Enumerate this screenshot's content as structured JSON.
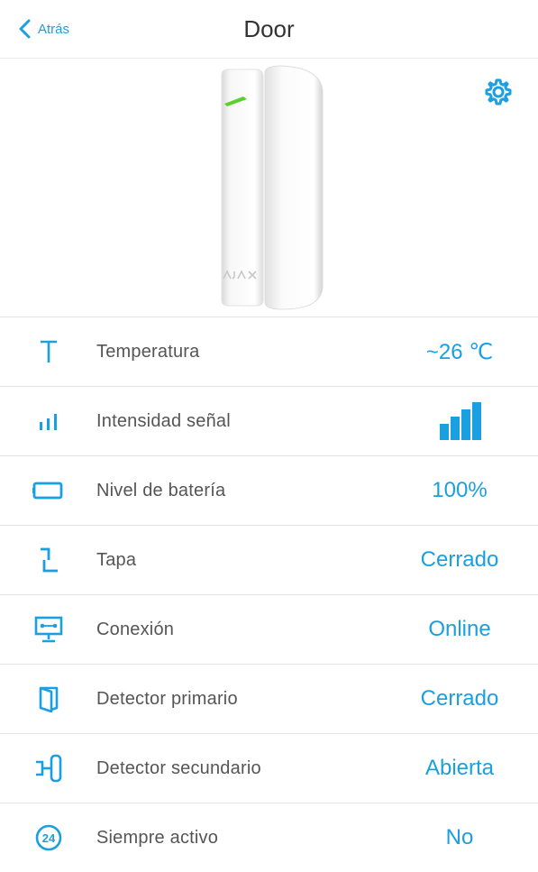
{
  "header": {
    "back_label": "Atrás",
    "title": "Door"
  },
  "hero": {
    "device_logo": "AJAX",
    "device_image": "door-contact-sensor"
  },
  "colors": {
    "accent": "#1a9fe0",
    "led": "#5ad12b"
  },
  "rows": [
    {
      "label": "Temperatura",
      "value": "~26 ℃",
      "icon": "temperature-icon"
    },
    {
      "label": "Intensidad señal",
      "value": "",
      "signal_level": 4,
      "signal_max": 4,
      "icon": "signal-icon"
    },
    {
      "label": "Nivel de batería",
      "value": "100%",
      "icon": "battery-icon"
    },
    {
      "label": "Tapa",
      "value": "Cerrado",
      "icon": "tamper-icon"
    },
    {
      "label": "Conexión",
      "value": "Online",
      "icon": "connection-icon"
    },
    {
      "label": "Detector primario",
      "value": "Cerrado",
      "icon": "primary-detector-icon"
    },
    {
      "label": "Detector secundario",
      "value": "Abierta",
      "icon": "secondary-detector-icon"
    },
    {
      "label": "Siempre activo",
      "value": "No",
      "icon": "always-active-icon"
    }
  ]
}
